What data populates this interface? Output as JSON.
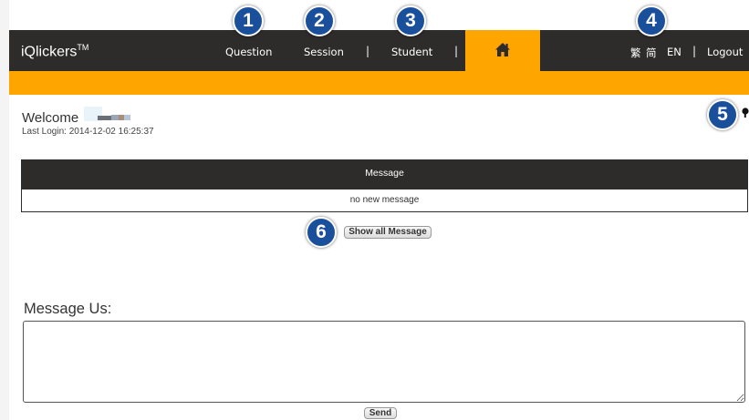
{
  "colors": {
    "accent": "#ffa500",
    "navbar": "#2e2b2b",
    "badge": "#1a4f9c"
  },
  "navbar": {
    "brand": "iQlickers",
    "brand_tm": "TM",
    "links": {
      "question": "Question",
      "session": "Session",
      "student": "Student"
    },
    "separator": "|",
    "home_icon": "home-icon",
    "lang": {
      "traditional": "繁",
      "simplified": "简",
      "english": "EN"
    },
    "logout": "Logout"
  },
  "welcome": {
    "text": "Welcome",
    "last_login": "Last Login: 2014-12-02 16:25:37"
  },
  "messages": {
    "header": "Message",
    "empty_text": "no new message",
    "show_all_label": "Show all Message"
  },
  "message_us": {
    "label": "Message Us:",
    "value": "",
    "send_label": "Send"
  },
  "annotations": [
    "1",
    "2",
    "3",
    "4",
    "5",
    "6"
  ]
}
